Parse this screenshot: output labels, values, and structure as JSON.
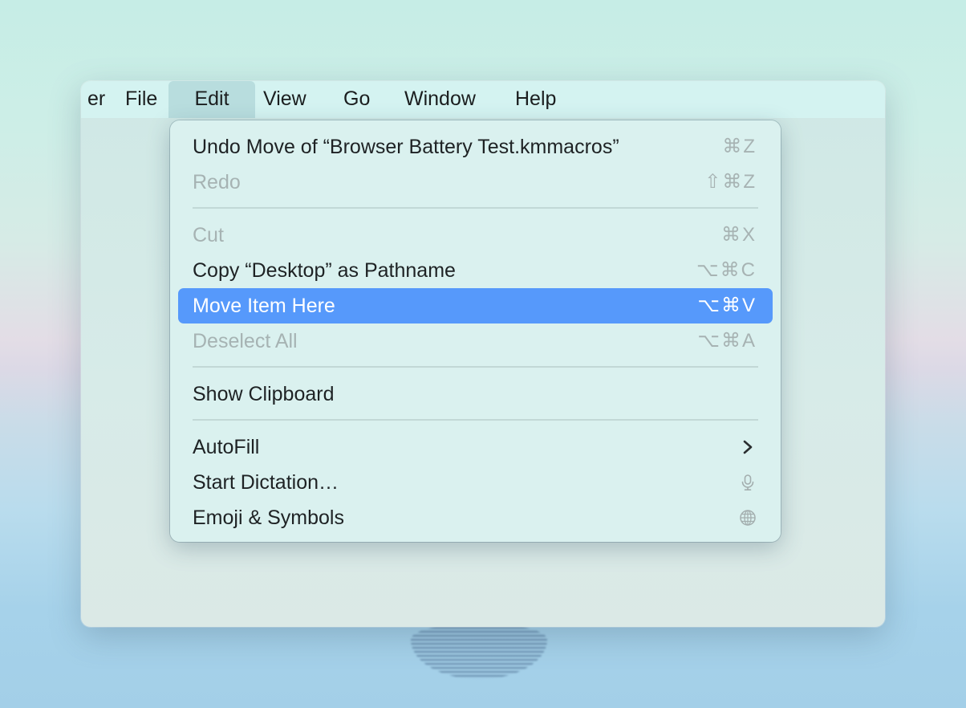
{
  "menubar": {
    "items": [
      {
        "label": "er"
      },
      {
        "label": "File"
      },
      {
        "label": "Edit"
      },
      {
        "label": "View"
      },
      {
        "label": "Go"
      },
      {
        "label": "Window"
      },
      {
        "label": "Help"
      }
    ],
    "active": "Edit"
  },
  "edit_menu": {
    "items": [
      {
        "label": "Undo Move of “Browser Battery Test.kmmacros”",
        "shortcut": "⌘Z",
        "enabled": true
      },
      {
        "label": "Redo",
        "shortcut": "⇧⌘Z",
        "enabled": false
      },
      {
        "label": "Cut",
        "shortcut": "⌘X",
        "enabled": false
      },
      {
        "label": "Copy “Desktop” as Pathname",
        "shortcut": "⌥⌘C",
        "enabled": true
      },
      {
        "label": "Move Item Here",
        "shortcut": "⌥⌘V",
        "enabled": true,
        "highlighted": true
      },
      {
        "label": "Deselect All",
        "shortcut": "⌥⌘A",
        "enabled": false
      },
      {
        "label": "Show Clipboard",
        "shortcut": "",
        "enabled": true
      },
      {
        "label": "AutoFill",
        "icon": "chevron-right-icon",
        "enabled": true
      },
      {
        "label": "Start Dictation…",
        "icon": "microphone-icon",
        "enabled": true
      },
      {
        "label": "Emoji & Symbols",
        "icon": "globe-icon",
        "enabled": true
      }
    ]
  },
  "colors": {
    "highlight": "#5699fb",
    "menu_background": "#daf1ee",
    "disabled_text": "#a6b3b3"
  }
}
